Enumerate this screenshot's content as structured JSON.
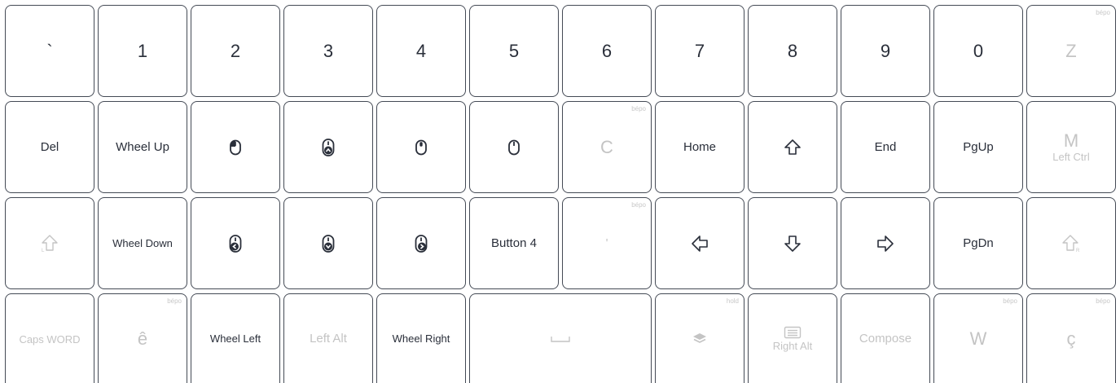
{
  "row1": {
    "backtick": "`",
    "k1": "1",
    "k2": "2",
    "k3": "3",
    "k4": "4",
    "k5": "5",
    "k6": "6",
    "k7": "7",
    "k8": "8",
    "k9": "9",
    "k0": "0",
    "z": "Z",
    "z_tag": "bépo"
  },
  "row2": {
    "del": "Del",
    "wheel_up": "Wheel Up",
    "c": "C",
    "c_tag": "bépo",
    "home": "Home",
    "end": "End",
    "pgup": "PgUp",
    "m": "M",
    "m_sub": "Left Ctrl",
    "icons": [
      "mouse-left-click-icon",
      "mouse-up-icon",
      "mouse-middle-click-icon",
      "mouse-right-click-icon",
      "up-arrow-icon"
    ]
  },
  "row3": {
    "wheel_down": "Wheel Down",
    "button4": "Button 4",
    "apos": "'",
    "apos_tag": "bépo",
    "pgdn": "PgDn",
    "shift_left_sub": "L",
    "shift_right_sub": "R",
    "icons": [
      "left-shift-icon",
      "mouse-left-icon",
      "mouse-down-icon",
      "mouse-right-icon",
      "left-arrow-icon",
      "down-arrow-icon",
      "right-arrow-icon",
      "right-shift-icon"
    ]
  },
  "row4": {
    "caps_word": "Caps WORD",
    "e_circ": "ê",
    "e_circ_tag": "bépo",
    "wheel_left": "Wheel Left",
    "left_alt": "Left Alt",
    "wheel_right": "Wheel Right",
    "layer_tag": "hold",
    "right_alt": "Right Alt",
    "compose": "Compose",
    "w": "W",
    "w_tag": "bépo",
    "c_cedil": "ç",
    "c_cedil_tag": "bépo",
    "icons": [
      "space-icon",
      "layers-icon",
      "menu-icon"
    ]
  },
  "colors": {
    "border": "#444a55",
    "text": "#2a2f3a",
    "dim": "#c4c4c4",
    "tag": "#c8c8c8"
  }
}
